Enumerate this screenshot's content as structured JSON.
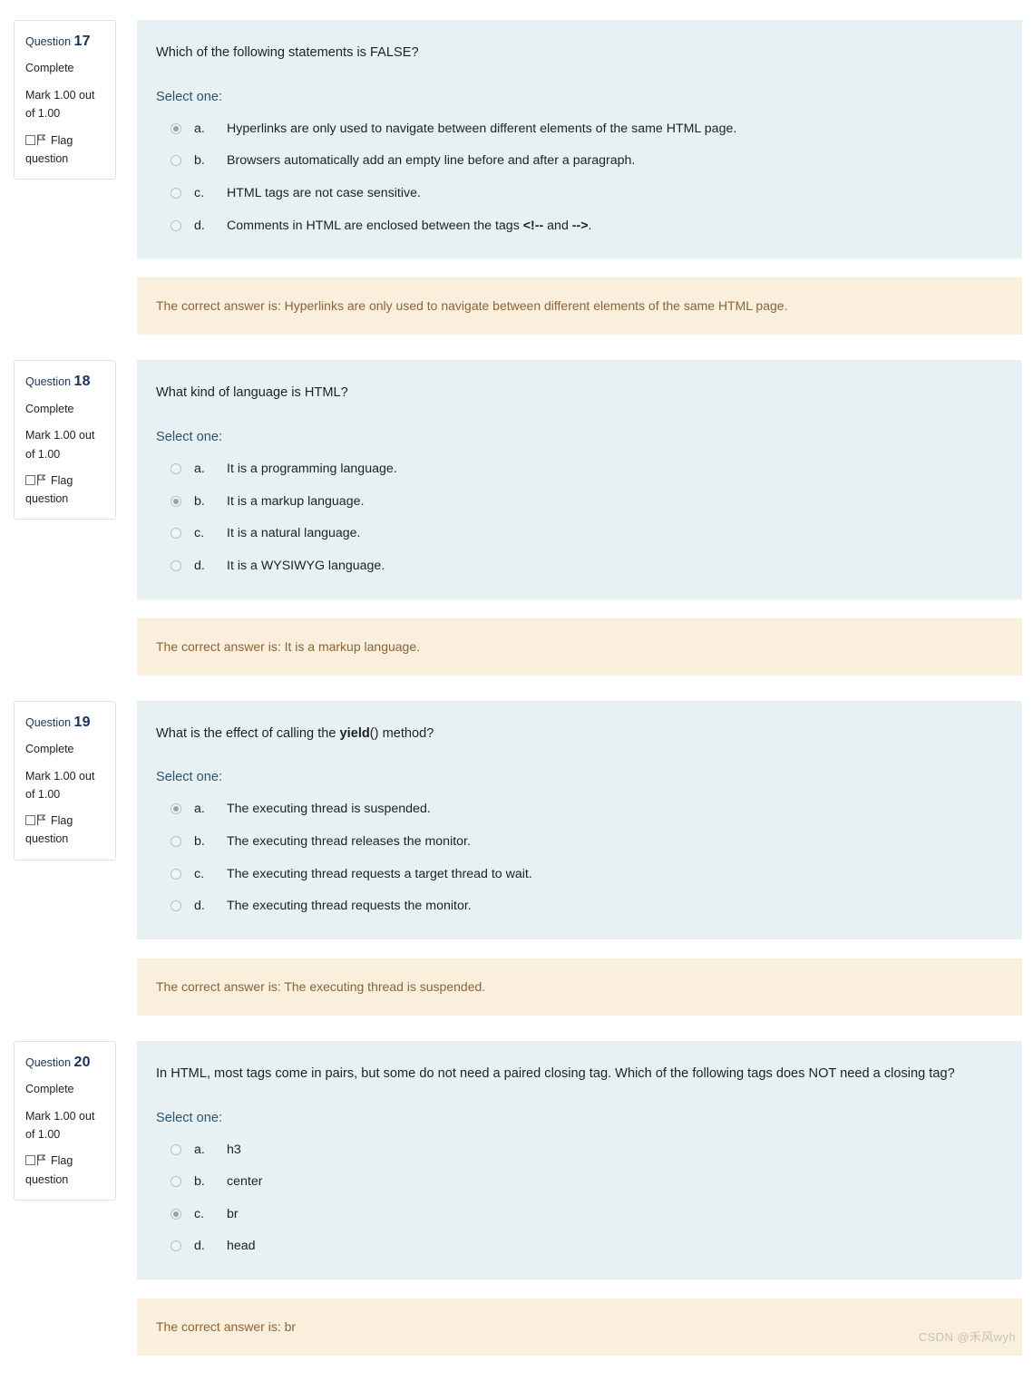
{
  "watermark": "CSDN @禾风wyh",
  "colors": {
    "question_bg": "#e7f1f3",
    "feedback_bg": "#faeedc",
    "feedback_text": "#8a6536",
    "select_one": "#2a5572",
    "question_number": "#16325c"
  },
  "labels": {
    "question_word": "Question",
    "select_one": "Select one:",
    "flag_question": "Flag question",
    "flag_checkbox_icon": "checkbox-unchecked-icon",
    "flag_icon": "flag-icon"
  },
  "questions": [
    {
      "number": "17",
      "state": "Complete",
      "grade": "Mark 1.00 out of 1.00",
      "text_parts": [
        {
          "text": "Which of the following statements is FALSE?",
          "bold": false
        }
      ],
      "text_plain": "Which of the following statements is FALSE?",
      "options": [
        {
          "label": "a.",
          "parts": [
            {
              "text": "Hyperlinks are only used to navigate between different elements of the same HTML page.",
              "bold": false
            }
          ],
          "text": "Hyperlinks are only used to navigate between different elements of the same HTML page.",
          "selected": true
        },
        {
          "label": "b.",
          "parts": [
            {
              "text": "Browsers automatically add an empty line before and after a paragraph.",
              "bold": false
            }
          ],
          "text": "Browsers automatically add an empty line before and after a paragraph.",
          "selected": false
        },
        {
          "label": "c.",
          "parts": [
            {
              "text": "HTML tags are not case sensitive.",
              "bold": false
            }
          ],
          "text": "HTML tags are not case sensitive.",
          "selected": false
        },
        {
          "label": "d.",
          "parts": [
            {
              "text": "Comments in HTML are enclosed between the tags ",
              "bold": false
            },
            {
              "text": "<!--",
              "bold": true
            },
            {
              "text": " and ",
              "bold": false
            },
            {
              "text": "-->",
              "bold": true
            },
            {
              "text": ".",
              "bold": false
            }
          ],
          "text": "Comments in HTML are enclosed between the tags <!-- and -->.",
          "selected": false
        }
      ],
      "feedback": "The correct answer is: Hyperlinks are only used to navigate between different elements of the same HTML page."
    },
    {
      "number": "18",
      "state": "Complete",
      "grade": "Mark 1.00 out of 1.00",
      "text_parts": [
        {
          "text": "What kind of language is HTML?",
          "bold": false
        }
      ],
      "text_plain": "What kind of language is HTML?",
      "options": [
        {
          "label": "a.",
          "parts": [
            {
              "text": "It is a programming language.",
              "bold": false
            }
          ],
          "text": "It is a programming language.",
          "selected": false
        },
        {
          "label": "b.",
          "parts": [
            {
              "text": "It is a markup language.",
              "bold": false
            }
          ],
          "text": "It is a markup language.",
          "selected": true
        },
        {
          "label": "c.",
          "parts": [
            {
              "text": "It is a natural language.",
              "bold": false
            }
          ],
          "text": "It is a natural language.",
          "selected": false
        },
        {
          "label": "d.",
          "parts": [
            {
              "text": "It is a WYSIWYG language.",
              "bold": false
            }
          ],
          "text": "It is a WYSIWYG language.",
          "selected": false
        }
      ],
      "feedback": "The correct answer is: It is a markup language."
    },
    {
      "number": "19",
      "state": "Complete",
      "grade": "Mark 1.00 out of 1.00",
      "text_parts": [
        {
          "text": "What is the effect of calling the ",
          "bold": false
        },
        {
          "text": "yield",
          "bold": true
        },
        {
          "text": "() method?",
          "bold": false
        }
      ],
      "text_plain": "What is the effect of calling the yield() method?",
      "options": [
        {
          "label": "a.",
          "parts": [
            {
              "text": "The executing thread is suspended.",
              "bold": false
            }
          ],
          "text": "The executing thread is suspended.",
          "selected": true
        },
        {
          "label": "b.",
          "parts": [
            {
              "text": "The executing thread releases the monitor.",
              "bold": false
            }
          ],
          "text": "The executing thread releases the monitor.",
          "selected": false
        },
        {
          "label": "c.",
          "parts": [
            {
              "text": "The executing thread requests a target thread to wait.",
              "bold": false
            }
          ],
          "text": "The executing thread requests a target thread to wait.",
          "selected": false
        },
        {
          "label": "d.",
          "parts": [
            {
              "text": "The executing thread requests the monitor.",
              "bold": false
            }
          ],
          "text": "The executing thread requests the monitor.",
          "selected": false
        }
      ],
      "feedback": "The correct answer is: The executing thread is suspended."
    },
    {
      "number": "20",
      "state": "Complete",
      "grade": "Mark 1.00 out of 1.00",
      "text_parts": [
        {
          "text": "In HTML, most tags come in pairs, but some do not need a paired closing tag. Which of the following tags does NOT need a closing tag?",
          "bold": false
        }
      ],
      "text_plain": "In HTML, most tags come in pairs, but some do not need a paired closing tag. Which of the following tags does NOT need a closing tag?",
      "options": [
        {
          "label": "a.",
          "parts": [
            {
              "text": "h3",
              "bold": false
            }
          ],
          "text": "h3",
          "selected": false
        },
        {
          "label": "b.",
          "parts": [
            {
              "text": "center",
              "bold": false
            }
          ],
          "text": "center",
          "selected": false
        },
        {
          "label": "c.",
          "parts": [
            {
              "text": "br",
              "bold": false
            }
          ],
          "text": "br",
          "selected": true
        },
        {
          "label": "d.",
          "parts": [
            {
              "text": "head",
              "bold": false
            }
          ],
          "text": "head",
          "selected": false
        }
      ],
      "feedback": "The correct answer is: br"
    }
  ]
}
